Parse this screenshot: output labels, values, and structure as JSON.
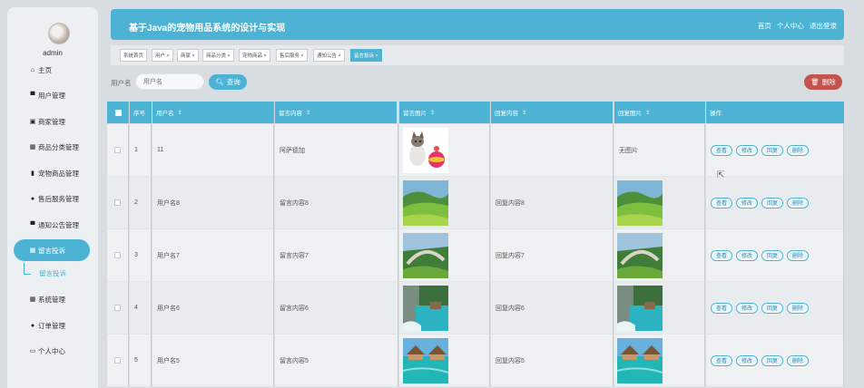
{
  "app": {
    "title": "基于Java的宠物用品系统的设计与实现",
    "header_links": [
      "首页",
      "个人中心",
      "退出登录"
    ]
  },
  "user": {
    "name": "admin"
  },
  "sidebar": {
    "items": [
      {
        "icon": "home-icon",
        "glyph": "⌂",
        "label": "主页"
      },
      {
        "icon": "monitor-icon",
        "glyph": "▀",
        "label": "用户管理"
      },
      {
        "icon": "store-icon",
        "glyph": "▣",
        "label": "商家管理"
      },
      {
        "icon": "grid-icon",
        "glyph": "▦",
        "label": "商品分类管理"
      },
      {
        "icon": "bar-chart-icon",
        "glyph": "▮",
        "label": "宠物商品管理"
      },
      {
        "icon": "person-icon",
        "glyph": "●",
        "label": "售后服务管理"
      },
      {
        "icon": "monitor-icon",
        "glyph": "▀",
        "label": "通知公告管理"
      },
      {
        "icon": "grid-icon",
        "glyph": "▦",
        "label": "留言投诉"
      },
      {
        "icon": "grid-icon",
        "glyph": "▦",
        "label": "系统管理"
      },
      {
        "icon": "person-icon",
        "glyph": "●",
        "label": "订单管理"
      },
      {
        "icon": "profile-icon",
        "glyph": "▭",
        "label": "个人中心"
      }
    ],
    "sub_item": "留言投诉"
  },
  "tabs": [
    "系统首页",
    "用户 ×",
    "商家 ×",
    "商品分类 ×",
    "宠物商品 ×",
    "售后服务 ×",
    "通知公告 ×",
    "留言投诉 ×"
  ],
  "search": {
    "label": "用户名",
    "placeholder": "用户名",
    "query_label": "查询",
    "delete_label": "删除"
  },
  "table": {
    "columns": [
      "",
      "序号",
      "用户名",
      "留言内容",
      "留言图片",
      "回复内容",
      "回复图片",
      "操作"
    ],
    "actions": [
      "查看",
      "修改",
      "回复",
      "删除"
    ],
    "rows": [
      {
        "index": "1",
        "username": "11",
        "content": "阿萨德加",
        "image": "cat",
        "reply": "",
        "reply_image": "无图片"
      },
      {
        "index": "2",
        "username": "用户名8",
        "content": "留言内容8",
        "image": "hills",
        "reply": "回复内容8",
        "reply_image": "hills"
      },
      {
        "index": "3",
        "username": "用户名7",
        "content": "留言内容7",
        "image": "bridge",
        "reply": "回复内容7",
        "reply_image": "bridge"
      },
      {
        "index": "4",
        "username": "用户名6",
        "content": "留言内容6",
        "image": "lake",
        "reply": "回复内容6",
        "reply_image": "lake"
      },
      {
        "index": "5",
        "username": "用户名5",
        "content": "留言内容5",
        "image": "bungalow",
        "reply": "回复内容5",
        "reply_image": "bungalow"
      }
    ]
  },
  "colors": {
    "accent": "#4db3d4",
    "danger": "#c4524f",
    "background": "#d7dde0"
  }
}
